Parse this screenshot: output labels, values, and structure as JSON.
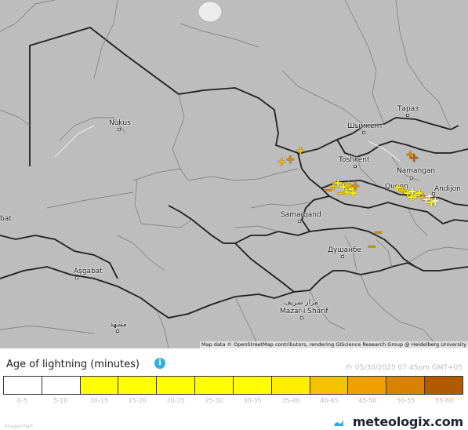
{
  "map": {
    "attribution": "Map data © OpenStreetMap contributors, rendering GIScience Research Group @ Heidelberg University",
    "cities": [
      {
        "id": "nukus",
        "name": "Nukus"
      },
      {
        "id": "taraz",
        "name": "Тараз"
      },
      {
        "id": "shymkent",
        "name": "Шымкент"
      },
      {
        "id": "toshkent",
        "name": "Toshkent"
      },
      {
        "id": "namangan",
        "name": "Namangan"
      },
      {
        "id": "quqon",
        "name": "Quqon"
      },
      {
        "id": "andijon",
        "name": "Andijon"
      },
      {
        "id": "samarqand",
        "name": "Samarqand"
      },
      {
        "id": "dushanbe",
        "name": "Душанбе"
      },
      {
        "id": "asgabat",
        "name": "Aşgabat"
      },
      {
        "id": "mashhad",
        "name": "مشهد"
      },
      {
        "id": "mazar",
        "name": "مزار شریف"
      },
      {
        "id": "mazar-latin",
        "name": "Mazar-i Sharif"
      },
      {
        "id": "edge",
        "name": "bat"
      }
    ],
    "strike_colors": {
      "recent": "#ffff00",
      "mid": "#f4c400",
      "old": "#e08a00",
      "oldest": "#b45d00",
      "fresh": "#ffffcc"
    }
  },
  "legend": {
    "title": "Age of lightning (minutes)",
    "info_icon": "i",
    "timestamp": "Fr 05/30/2025 07:45pm GMT+05",
    "scale": [
      {
        "label": "0-5",
        "color": "#ffffff"
      },
      {
        "label": "5-10",
        "color": "#ffffff"
      },
      {
        "label": "10-15",
        "color": "#ffff00"
      },
      {
        "label": "15-20",
        "color": "#ffff00"
      },
      {
        "label": "20-25",
        "color": "#ffff00"
      },
      {
        "label": "25-30",
        "color": "#ffff00"
      },
      {
        "label": "30-35",
        "color": "#ffff00"
      },
      {
        "label": "35-40",
        "color": "#ffee00"
      },
      {
        "label": "40-45",
        "color": "#f5c200"
      },
      {
        "label": "45-50",
        "color": "#efa000"
      },
      {
        "label": "50-55",
        "color": "#d98200"
      },
      {
        "label": "55-60",
        "color": "#b25a00"
      }
    ],
    "footnote": "Image/chart",
    "brand": "meteologix.com"
  }
}
